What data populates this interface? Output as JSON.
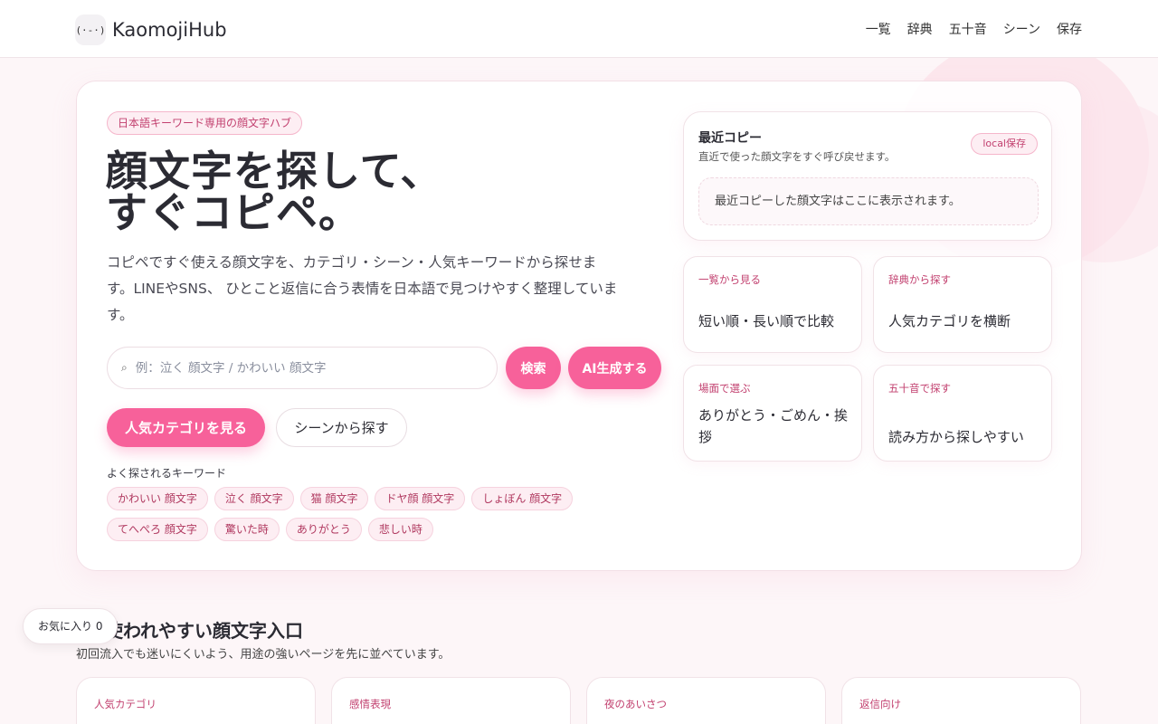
{
  "header": {
    "logo_icon": "(·-·)",
    "logo_text": "KaomojiHub",
    "nav": [
      "一覧",
      "辞典",
      "五十音",
      "シーン",
      "保存"
    ]
  },
  "hero": {
    "tagline": "日本語キーワード専用の顔文字ハブ",
    "title_line1": "顔文字を探して、",
    "title_line2": "すぐコピペ。",
    "description": "コピペですぐ使える顔文字を、カテゴリ・シーン・人気キーワードから探せます。LINEやSNS、 ひとこと返信に合う表情を日本語で見つけやすく整理しています。",
    "search": {
      "icon": "search-icon",
      "placeholder": "例：泣く 顔文字 / かわいい 顔文字"
    },
    "search_button": "検索",
    "ai_button": "AI生成する",
    "category_button": "人気カテゴリを見る",
    "scene_button": "シーンから探す",
    "keywords_title": "よく探されるキーワード",
    "keywords": [
      "かわいい 顔文字",
      "泣く 顔文字",
      "猫 顔文字",
      "ドヤ顔 顔文字",
      "しょぼん 顔文字",
      "てへぺろ 顔文字",
      "驚いた時",
      "ありがとう",
      "悲しい時"
    ]
  },
  "recent": {
    "title": "最近コピー",
    "subtitle": "直近で使った顔文字をすぐ呼び戻せます。",
    "badge": "local保存",
    "empty_text": "最近コピーした顔文字はここに表示されます。"
  },
  "quick_cards": [
    {
      "label": "一覧から見る",
      "text": "短い順・長い順で比較"
    },
    {
      "label": "辞典から探す",
      "text": "人気カテゴリを横断"
    },
    {
      "label": "場面で選ぶ",
      "text": "ありがとう・ごめん・挨拶"
    },
    {
      "label": "五十音で探す",
      "text": "読み方から探しやすい"
    }
  ],
  "section": {
    "title": "使われやすい顔文字入口",
    "subtitle": "初回流入でも迷いにくいよう、用途の強いページを先に並べています。",
    "cards": [
      "人気カテゴリ",
      "感情表現",
      "夜のあいさつ",
      "返信向け"
    ]
  },
  "favorites": {
    "label": "お気に入り",
    "count": "0"
  },
  "colors": {
    "accent": "#f7619a",
    "accent_text": "#c2406f",
    "background": "#fdf6f8"
  }
}
